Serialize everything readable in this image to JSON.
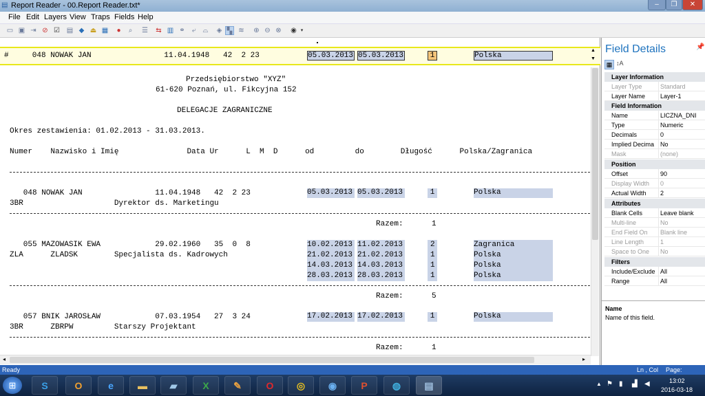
{
  "window": {
    "title": "Report Reader - 00.Report Reader.txt*"
  },
  "menu": [
    "File",
    "Edit",
    "Layers",
    "View",
    "Traps",
    "Fields",
    "Help"
  ],
  "trap": {
    "marker": "#",
    "line": "   048 NOWAK JAN                11.04.1948   42  2 23",
    "od": "05.03.2013",
    "do": "05.03.2013",
    "dlugosc": "1",
    "kraj": "Polska"
  },
  "report": {
    "company": "Przedsiębiorstwo \"XYZ\"",
    "address": "61-620 Poznań, ul. Fikcyjna 152",
    "title": "DELEGACJE ZAGRANICZNE",
    "period": "Okres zestawienia: 01.02.2013 - 31.03.2013.",
    "header": "Numer    Nazwisko i Imię               Data Ur      L  M  D      od         do        Długość      Polska/Zagranica",
    "records": [
      {
        "line": "   048 NOWAK JAN                11.04.1948   42  2 23",
        "sub": "3BR                    Dyrektor ds. Marketingu",
        "trips": [
          {
            "od": "05.03.2013",
            "do": "05.03.2013",
            "d": "1",
            "k": "Polska"
          }
        ],
        "razem_label": "Razem:",
        "razem": "1"
      },
      {
        "line": "   055 MAZOWASIK EWA            29.02.1960   35  0  8",
        "sub": "ZLA      ZLADSK        Specjalista ds. Kadrowych",
        "trips": [
          {
            "od": "10.02.2013",
            "do": "11.02.2013",
            "d": "2",
            "k": "Zagranica"
          },
          {
            "od": "21.02.2013",
            "do": "21.02.2013",
            "d": "1",
            "k": "Polska"
          },
          {
            "od": "14.03.2013",
            "do": "14.03.2013",
            "d": "1",
            "k": "Polska"
          },
          {
            "od": "28.03.2013",
            "do": "28.03.2013",
            "d": "1",
            "k": "Polska"
          }
        ],
        "razem_label": "Razem:",
        "razem": "5"
      },
      {
        "line": "   057 BNIK JAROSŁAW            07.03.1954   27  3 24",
        "sub": "3BR      ZBRPW         Starszy Projektant",
        "trips": [
          {
            "od": "17.02.2013",
            "do": "17.02.2013",
            "d": "1",
            "k": "Polska"
          }
        ],
        "razem_label": "Razem:",
        "razem": "1"
      }
    ]
  },
  "panel": {
    "title": "Field Details",
    "pin": "ᵖ",
    "sections": [
      {
        "name": "Layer Information",
        "rows": [
          {
            "k": "Layer Type",
            "v": "Standard",
            "disabled": true
          },
          {
            "k": "Layer Name",
            "v": "Layer-1"
          }
        ]
      },
      {
        "name": "Field Information",
        "rows": [
          {
            "k": "Name",
            "v": "LICZNA_DNI"
          },
          {
            "k": "Type",
            "v": "Numeric"
          },
          {
            "k": "Decimals",
            "v": "0"
          },
          {
            "k": "Implied Decima",
            "v": "No"
          },
          {
            "k": "Mask",
            "v": "(none)",
            "disabled": true
          }
        ]
      },
      {
        "name": "Position",
        "rows": [
          {
            "k": "Offset",
            "v": "90"
          },
          {
            "k": "Display Width",
            "v": "0",
            "disabled": true
          },
          {
            "k": "Actual Width",
            "v": "2"
          }
        ]
      },
      {
        "name": "Attributes",
        "rows": [
          {
            "k": "Blank Cells",
            "v": "Leave blank"
          },
          {
            "k": "Multi-line",
            "v": "No",
            "disabled": true
          },
          {
            "k": "End Field On",
            "v": "Blank line",
            "disabled": true
          },
          {
            "k": "Line Length",
            "v": "1",
            "disabled": true
          },
          {
            "k": "Space to One",
            "v": "No",
            "disabled": true
          }
        ]
      },
      {
        "name": "Filters",
        "rows": [
          {
            "k": "Include/Exclude",
            "v": "All"
          },
          {
            "k": "Range",
            "v": "All"
          }
        ]
      }
    ],
    "help_title": "Name",
    "help_text": "Name of this field."
  },
  "status": {
    "left": "Ready",
    "pos": "Ln , Col",
    "page": "Page:"
  },
  "clock": {
    "time": "13:02",
    "date": "2016-03-18"
  },
  "colors": {
    "accent": "#2d64b8",
    "highlight": "#c9d3e7",
    "trapline": "#e8e81a"
  }
}
